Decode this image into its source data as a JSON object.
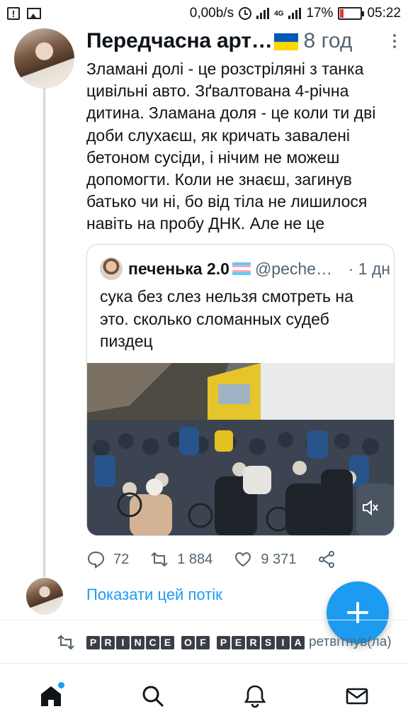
{
  "status_bar": {
    "net_speed": "0,00b/s",
    "network_type": "4G",
    "battery_percent": "17%",
    "battery_level": 0.17,
    "time": "05:22",
    "icons": [
      "notification-icon",
      "image-icon",
      "alarm-icon",
      "signal-icon",
      "battery-icon"
    ]
  },
  "tweet": {
    "author_name": "Передчасна арт…",
    "time_ago": "8 год",
    "text": "Зламані долі - це розстріляні з танка цивільні авто. Зґвалтована 4-річна дитина. Зламана доля - це коли ти дві доби слухаєш, як кричать завалені бетоном сусіди, і нічим не можеш допомогти. Коли не знаєш, загинув батько чи ні, бо від тіла не лишилося навіть на пробу ДНК. Але не це",
    "quoted": {
      "author_name": "печенька 2.0",
      "handle": "@peche…",
      "time_ago": "· 1 дн",
      "text": "сука без слез нельзя смотреть на это. сколько сломанных судеб пиздец"
    },
    "replies": "72",
    "retweets": "1 884",
    "likes": "9 371"
  },
  "show_thread_label": "Показати цей потік",
  "retweet_row": {
    "retweeter_letters": [
      "PRINCE",
      "OF",
      "PERSIA"
    ],
    "suffix": "ретвітнув(ла)"
  },
  "nav": [
    "home-icon",
    "search-icon",
    "notifications-icon",
    "messages-icon"
  ],
  "colors": {
    "accent": "#1d9bf0",
    "secondary_text": "#536471",
    "flag_blue": "#0057b7",
    "flag_yellow": "#ffd700"
  }
}
